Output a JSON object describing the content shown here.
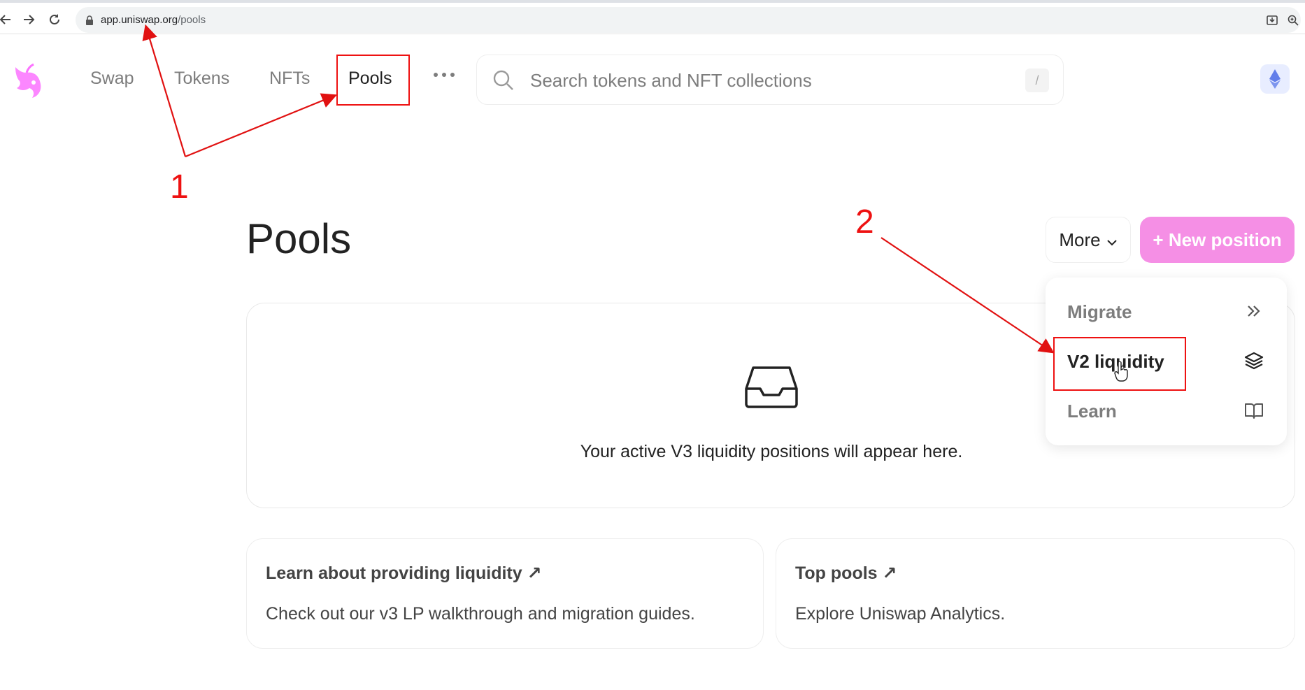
{
  "browser": {
    "url_host": "app.uniswap.org",
    "url_path": "/pools",
    "icons": [
      "back-arrow-icon",
      "forward-arrow-icon",
      "reload-icon",
      "lock-icon",
      "install-app-icon",
      "zoom-icon"
    ]
  },
  "header": {
    "logo": "uniswap-unicorn-logo",
    "nav": [
      "Swap",
      "Tokens",
      "NFTs",
      "Pools"
    ],
    "active_nav": "Pools",
    "more_icon": "more-dots-icon",
    "search": {
      "placeholder": "Search tokens and NFT collections",
      "shortcut": "/"
    },
    "chain_icon": "ethereum-icon"
  },
  "page": {
    "title": "Pools",
    "more_button": "More",
    "new_position_button": "+ New position",
    "accent_color": "#f58fe5",
    "empty_state": {
      "icon": "inbox-icon",
      "text": "Your active V3 liquidity positions will appear here."
    },
    "cards": [
      {
        "title": "Learn about providing liquidity ↗",
        "description": "Check out our v3 LP walkthrough and migration guides."
      },
      {
        "title": "Top pools ↗",
        "description": "Explore Uniswap Analytics."
      }
    ]
  },
  "dropdown": {
    "items": [
      {
        "label": "Migrate",
        "icon": "double-chevron-right-icon"
      },
      {
        "label": "V2 liquidity",
        "icon": "layers-icon"
      },
      {
        "label": "Learn",
        "icon": "book-icon"
      }
    ]
  },
  "annotations": {
    "markers": [
      "1",
      "2"
    ],
    "color": "#e11111"
  }
}
